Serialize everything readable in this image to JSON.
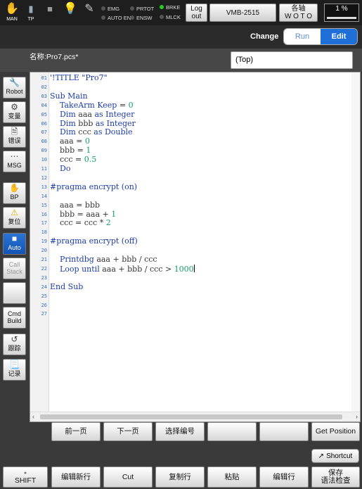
{
  "status_bar": {
    "man_label": "MAN",
    "tp_label": "TP",
    "lamps": [
      {
        "label": "EMG",
        "on": false
      },
      {
        "label": "PRTOT",
        "on": false
      },
      {
        "label": "BRKE",
        "on": true
      },
      {
        "label": "AUTO EN",
        "on": false
      },
      {
        "label": "ENSW",
        "on": false
      },
      {
        "label": "MLCK",
        "on": false
      }
    ],
    "logout_line1": "Log",
    "logout_line2": "out",
    "robot_name": "VMB-2515",
    "axis_line1": "各轴",
    "axis_line2": "W O T O",
    "speed": "1 %",
    "lamp_on_color": "#22cc22"
  },
  "mode_bar": {
    "change_label": "Change",
    "run_label": "Run",
    "edit_label": "Edit",
    "active_mode": "Edit"
  },
  "file_bar": {
    "file_name": "名称:Pro7.pcs*",
    "scope": "(Top)"
  },
  "side_buttons": [
    {
      "label": "Robot",
      "icon": "wrench-icon"
    },
    {
      "label": "变量",
      "icon": "gear-icon"
    },
    {
      "label": "错误",
      "icon": "error-doc-icon"
    },
    {
      "label": "MSG",
      "icon": "message-icon"
    },
    {
      "label": "BP",
      "icon": "hand-icon"
    },
    {
      "label": "复位",
      "icon": "warning-icon"
    },
    {
      "label": "Auto",
      "icon": "auto-icon",
      "active": true
    },
    {
      "label": "Call Stack",
      "icon": "",
      "disabled": true
    },
    {
      "label": "",
      "icon": ""
    },
    {
      "label": "Cmd Build",
      "icon": ""
    },
    {
      "label": "跟踪",
      "icon": "trace-icon"
    },
    {
      "label": "记录",
      "icon": "record-icon"
    }
  ],
  "editor": {
    "line_numbers": [
      "01",
      "02",
      "03",
      "04",
      "05",
      "06",
      "07",
      "08",
      "09",
      "10",
      "11",
      "12",
      "13",
      "14",
      "15",
      "16",
      "17",
      "18",
      "19",
      "20",
      "21",
      "22",
      "23",
      "24",
      "25",
      "26",
      "27"
    ],
    "lines": [
      "'!TITLE \"Pro7\"",
      "",
      "Sub Main",
      "    TakeArm Keep = 0",
      "    Dim aaa as Integer",
      "    Dim bbb as Integer",
      "    Dim ccc as Double",
      "    aaa = 0",
      "    bbb = 1",
      "    ccc = 0.5",
      "    Do",
      "",
      "#pragma encrypt (on)",
      "",
      "    aaa = bbb",
      "    bbb = aaa + 1",
      "    ccc = ccc * 2",
      "",
      "#pragma encrypt (off)",
      "",
      "    Printdbg aaa + bbb / ccc",
      "    Loop until aaa + bbb / ccc > 1000",
      "",
      "End Sub",
      "",
      "",
      ""
    ]
  },
  "function_keys": [
    "前一页",
    "下一页",
    "选择编号",
    "",
    "",
    "Get Position"
  ],
  "shortcut_label": "Shortcut",
  "bottom_keys": {
    "shift": "SHIFT",
    "keys": [
      "编辑新行",
      "Cut",
      "复制行",
      "粘贴",
      "编辑行"
    ],
    "save_line1": "保存",
    "save_line2": "语法检查"
  }
}
